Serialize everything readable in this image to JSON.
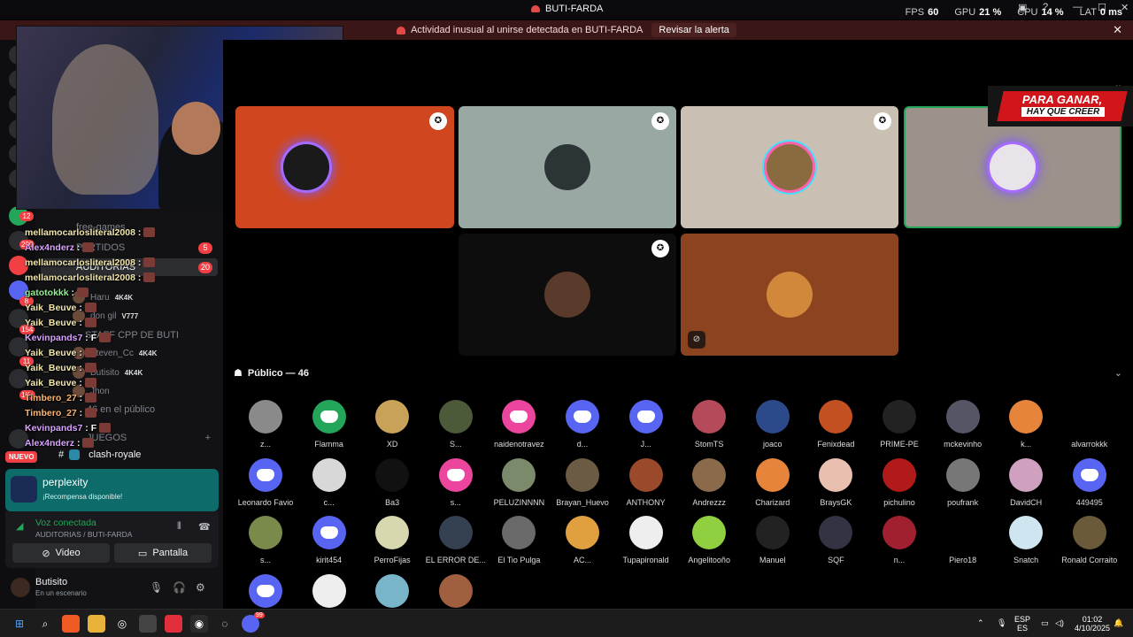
{
  "titlebar": {
    "server_name": "BUTI-FARDA",
    "stats": [
      {
        "label": "FPS",
        "value": "60"
      },
      {
        "label": "GPU",
        "value": "21 %"
      },
      {
        "label": "CPU",
        "value": "14 %"
      },
      {
        "label": "LAT",
        "value": "0 ms"
      }
    ]
  },
  "alert": {
    "message": "Actividad inusual al unirse detectada en BUTI-FARDA",
    "review_label": "Revisar la alerta"
  },
  "channels": [
    {
      "label": "free-games"
    },
    {
      "label": "PARTIDOS",
      "count": "5"
    },
    {
      "label": "AUDITORIAS",
      "count": "20"
    },
    {
      "label": "STAFF CPP DE BUTI"
    },
    {
      "label": "46 en el público"
    },
    {
      "label": "JUEGOS"
    },
    {
      "label": "clash-royale"
    }
  ],
  "members": [
    {
      "name": "Haru",
      "tag": "4K4K"
    },
    {
      "name": "don gil",
      "tag": "V777"
    },
    {
      "name": "Steven_Cc",
      "tag": "4K4K"
    },
    {
      "name": "Butisito",
      "tag": "4K4K"
    },
    {
      "name": "Jhon",
      "tag": ""
    }
  ],
  "guild_badges": [
    "12",
    "290",
    "8",
    "154",
    "11",
    "1K+"
  ],
  "chat_overlay": [
    {
      "user": "mellamocarlosliteral2008",
      "text": ":"
    },
    {
      "user": "Alex4nderz",
      "text": ":"
    },
    {
      "user": "mellamocarlosliteral2008",
      "text": ":"
    },
    {
      "user": "mellamocarlosliteral2008",
      "text": ":"
    },
    {
      "user": "gatotokkk",
      "text": ":"
    },
    {
      "user": "Yaik_Beuve",
      "text": ":"
    },
    {
      "user": "Yaik_Beuve",
      "text": ":"
    },
    {
      "user": "Kevinpands7",
      "text": ": F"
    },
    {
      "user": "Yaik_Beuve",
      "text": ":"
    },
    {
      "user": "Yaik_Beuve",
      "text": ":"
    },
    {
      "user": "Yaik_Beuve",
      "text": ":"
    },
    {
      "user": "Timbero_27",
      "text": ":"
    },
    {
      "user": "Timbero_27",
      "text": ":"
    },
    {
      "user": "Kevinpands7",
      "text": ": F"
    },
    {
      "user": "Alex4nderz",
      "text": ":"
    }
  ],
  "nuevo_label": "NUEVO",
  "promo": {
    "title": "perplexity",
    "subtitle": "¡Recompensa disponible!"
  },
  "voice": {
    "status": "Voz conectada",
    "path": "AUDITORIAS / BUTI-FARDA",
    "video_label": "Video",
    "screen_label": "Pantalla"
  },
  "user": {
    "name": "Butisito",
    "status": "En un escenario"
  },
  "banner": {
    "line1": "PARA GANAR,",
    "line2": "HAY QUE CREER"
  },
  "audience_header": "Público — 46",
  "audience": [
    "z...",
    "Flamma",
    "XD",
    "S...",
    "naidenotravez",
    "d...",
    "J...",
    "StomTS",
    "joaco",
    "Fenixdead",
    "PRIME-PE",
    "mckevinho",
    "k...",
    "alvarrokkk",
    "Leonardo Favio",
    "c...",
    "Ba3",
    "s...",
    "PELUZINNNN",
    "Brayan_Huevo",
    "ANTHONY",
    "Andrezzz",
    "Charizard",
    "BraysGK",
    "pichulino",
    "poufrank",
    "DavidCH",
    "449495",
    "s...",
    "kirit454",
    "PerroFijas",
    "EL ERROR DE...",
    "El Tio Pulga",
    "AC...",
    "Tupapironald",
    "Angelitooño",
    "Manuel",
    "SQF",
    "n...",
    "Piero18",
    "Snatch",
    "Ronald Corraito",
    "",
    "",
    "",
    ""
  ],
  "taskbar": {
    "lang": "ESP",
    "lang2": "ES",
    "time": "01:02",
    "date": "4/10/2025",
    "badge": "99"
  },
  "colors": {
    "accent": "#5865f2",
    "green": "#23a55a",
    "red": "#f23f43",
    "promo": "#0d6b6a"
  }
}
